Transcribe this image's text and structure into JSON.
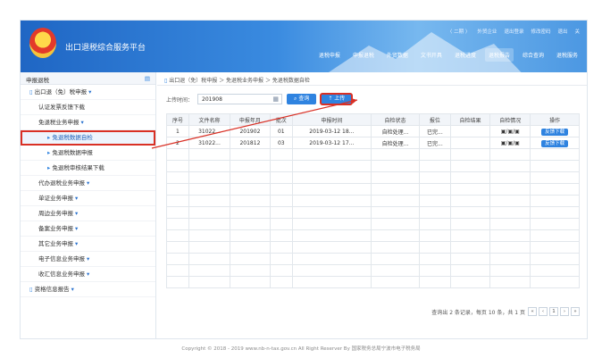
{
  "app": {
    "title": "出口退税综合服务平台"
  },
  "toplinks": [
    "〈 二期 〉",
    "外贸企业",
    "退出登录",
    "修改密码",
    "退出",
    "关"
  ],
  "nav": [
    {
      "label": "退税申报",
      "active": false
    },
    {
      "label": "申报退税",
      "active": false
    },
    {
      "label": "外贸数据",
      "active": false
    },
    {
      "label": "文书开具",
      "active": false
    },
    {
      "label": "退税进度",
      "active": false
    },
    {
      "label": "退税报告",
      "active": true
    },
    {
      "label": "综合查询",
      "active": false
    },
    {
      "label": "退税服务",
      "active": false
    }
  ],
  "sidebar": {
    "head": "申报退税",
    "items": [
      {
        "label": "出口退（免）税申报",
        "level": "l0",
        "caret": "▾",
        "selected": false
      },
      {
        "label": "认证发票反馈下载",
        "level": "l1",
        "caret": "",
        "selected": false
      },
      {
        "label": "免退税业务申报",
        "level": "l1",
        "caret": "▾",
        "selected": false
      },
      {
        "label": "免退税数据自检",
        "level": "l2",
        "caret": "",
        "selected": true
      },
      {
        "label": "免退税数据申报",
        "level": "l2",
        "caret": "",
        "selected": false
      },
      {
        "label": "免退税审核结果下载",
        "level": "l2",
        "caret": "",
        "selected": false
      },
      {
        "label": "代办退税业务申报",
        "level": "l1",
        "caret": "▾",
        "selected": false
      },
      {
        "label": "单证业务申报",
        "level": "l1",
        "caret": "▾",
        "selected": false
      },
      {
        "label": "周边业务申报",
        "level": "l1",
        "caret": "▾",
        "selected": false
      },
      {
        "label": "备案业务申报",
        "level": "l1",
        "caret": "▾",
        "selected": false
      },
      {
        "label": "其它业务申报",
        "level": "l1",
        "caret": "▾",
        "selected": false
      },
      {
        "label": "电子信息业务申报",
        "level": "l1",
        "caret": "▾",
        "selected": false
      },
      {
        "label": "收汇信息业务申报",
        "level": "l1",
        "caret": "▾",
        "selected": false
      },
      {
        "label": "资格信息报告",
        "level": "l0",
        "caret": "▾",
        "selected": false
      }
    ]
  },
  "breadcrumb": "出口退（免）税申报 ＞ 免退税业务申报 ＞ 免退税数据自检",
  "search": {
    "label": "上传时间：",
    "value": "201908",
    "query_label": "查询",
    "upload_label": "上传"
  },
  "table": {
    "headers": [
      "序号",
      "文件名称",
      "申报年月",
      "批次",
      "申报时间",
      "自检状态",
      "报位",
      "自检结果",
      "自检情况",
      "操作"
    ],
    "rows": [
      [
        "1",
        "31022...",
        "201902",
        "01",
        "2019-03-12 18...",
        "自检处理...",
        "已完...",
        "",
        "▣/▣/▣",
        "反馈下载"
      ],
      [
        "2",
        "31022...",
        "201812",
        "03",
        "2019-03-12 17...",
        "自检处理...",
        "已完...",
        "",
        "▣/▣/▣",
        "反馈下载"
      ]
    ]
  },
  "pager": {
    "info": "查询出 2 条记录，每页 10 条，共 1 页",
    "buttons": [
      "«",
      "‹",
      "1",
      "›",
      "»"
    ]
  },
  "footer": "Copyright © 2018 - 2019 www.nb-n-tax.gov.cn All Right Reserver By 国家税务总局宁波市电子税务局",
  "colors": {
    "header_start": "#1f66c4",
    "accent": "#2f83e0",
    "highlight": "#d93025"
  }
}
